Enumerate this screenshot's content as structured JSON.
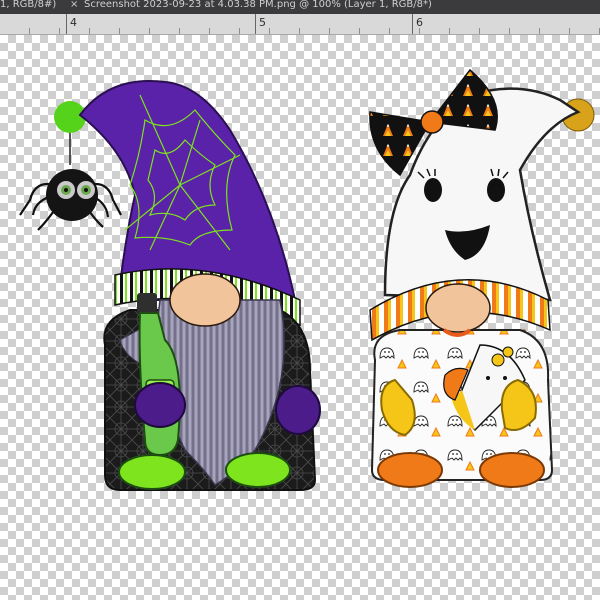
{
  "tabbar": {
    "prev_tab_title": "1, RGB/8#)",
    "close_glyph": "×",
    "active_tab_title": "Screenshot 2023-09-23 at 4.03.38 PM.png @ 100% (Layer 1, RGB/8*)"
  },
  "ruler": {
    "labels": [
      "4",
      "5",
      "6"
    ]
  },
  "artwork": {
    "left_gnome": "witch-gnome",
    "right_gnome": "ghost-gnome",
    "colors": {
      "purple": "#5a22a8",
      "lime": "#7de41d",
      "candy_orange": "#f07a18",
      "candy_yellow": "#f5c518",
      "ghost_white": "#f7f7f7"
    }
  }
}
